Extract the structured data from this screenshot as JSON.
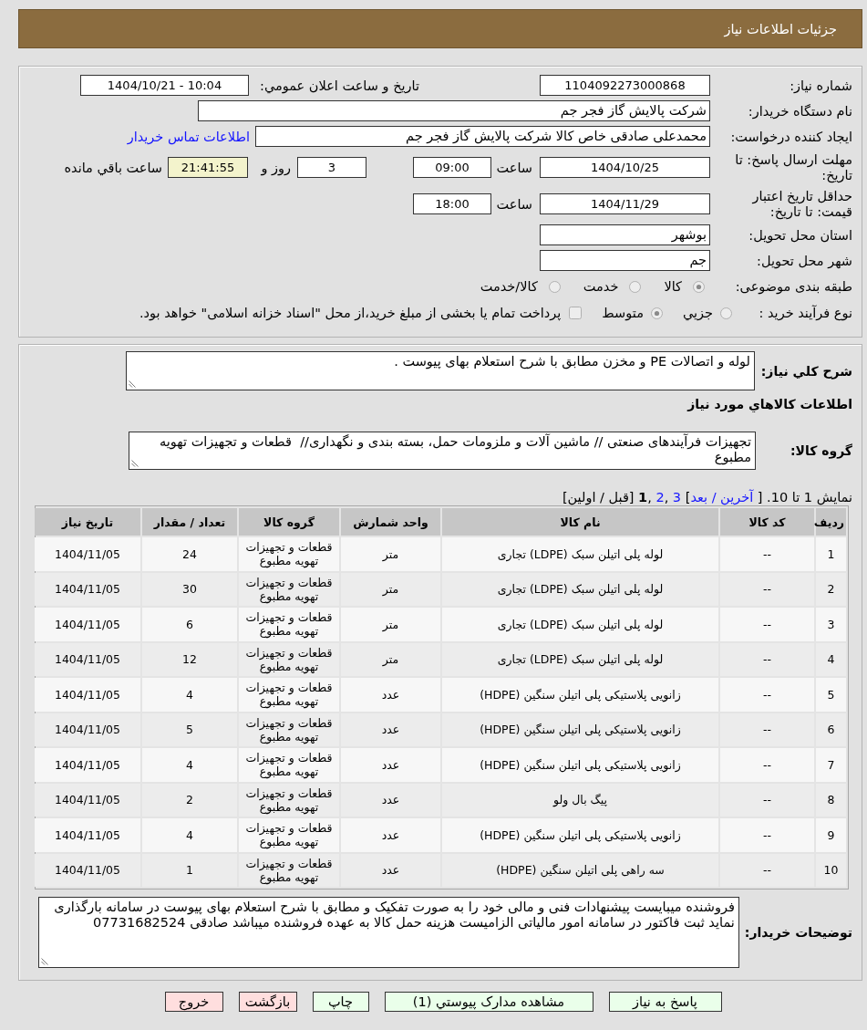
{
  "page": {
    "title": "جزئیات اطلاعات نیاز"
  },
  "details": {
    "need_number": {
      "label": "شماره نیاز:",
      "value": "1104092273000868"
    },
    "announce": {
      "label": "تاريخ و ساعت اعلان عمومي:",
      "value": "1404/10/21 - 10:04"
    },
    "buyer_org": {
      "label": "نام دستگاه خريدار:",
      "value": "شرکت پالايش گاز فجر جم"
    },
    "requester": {
      "label": "ايجاد کننده درخواست:",
      "value": "محمدعلی صادقی خاص کالا شرکت پالایش گاز فجر جم",
      "link": "اطلاعات تماس خريدار"
    },
    "reply_deadline": {
      "label": "مهلت ارسال پاسخ: تا تاریخ:",
      "date": "1404/10/25",
      "time_label": "ساعت",
      "time": "09:00",
      "days": "3",
      "days_label": "روز و",
      "remaining": "21:41:55",
      "remaining_label": "ساعت باقي مانده"
    },
    "price_validity": {
      "label": "حداقل تاريخ اعتبار قيمت: تا تاريخ:",
      "date": "1404/11/29",
      "time_label": "ساعت",
      "time": "18:00"
    },
    "province": {
      "label": "استان محل تحويل:",
      "value": "بوشهر"
    },
    "city": {
      "label": "شهر محل تحويل:",
      "value": "جم"
    },
    "category": {
      "label": "طبقه بندی موضوعی:",
      "options": [
        {
          "label": "کالا",
          "selected": true
        },
        {
          "label": "خدمت",
          "selected": false
        },
        {
          "label": "کالا/خدمت",
          "selected": false
        }
      ]
    },
    "purchase_type": {
      "label": "نوع فرآيند خريد :",
      "options": [
        {
          "label": "جزيي",
          "selected": false
        },
        {
          "label": "متوسط",
          "selected": true
        }
      ],
      "treasury": {
        "label": "پرداخت تمام یا بخشی از مبلغ خرید،از محل \"اسناد خزانه اسلامی\" خواهد بود.",
        "checked": false
      }
    }
  },
  "needs": {
    "description": {
      "label": "شرح کلي نياز:",
      "value": "لوله و اتصالات PE و مخزن مطابق با شرح استعلام بهای پیوست ."
    },
    "items_heading": "اطلاعات کالاهاي مورد نياز",
    "product_group": {
      "label": "گروه کالا:",
      "value": "تجهیزات فرآیندهای صنعتی // ماشین آلات و ملزومات حمل، بسته بندی و نگهداری//  قطعات و تجهیزات تهویه مطبوع"
    },
    "pagination": {
      "parts": [
        {
          "kind": "text",
          "text": "نمايش 1 تا 10. [ "
        },
        {
          "kind": "link",
          "text": "آخرين / بعد"
        },
        {
          "kind": "text",
          "text": "] "
        },
        {
          "kind": "link",
          "text": "3"
        },
        {
          "kind": "text",
          "text": " ,"
        },
        {
          "kind": "link",
          "text": "2"
        },
        {
          "kind": "text",
          "text": " ,"
        },
        {
          "kind": "current",
          "text": "1"
        },
        {
          "kind": "text",
          "text": " [قبل / اولين]"
        }
      ]
    },
    "table": {
      "columns": [
        "ردیف",
        "کد کالا",
        "نام کالا",
        "واحد شمارش",
        "گروه کالا",
        "تعداد / مقدار",
        "تاریخ نیاز"
      ],
      "rows": [
        [
          "1",
          "--",
          "لوله پلی اتیلن سبک (LDPE) تجاری",
          "متر",
          "قطعات و تجهیزات تهویه مطبوع",
          "24",
          "1404/11/05"
        ],
        [
          "2",
          "--",
          "لوله پلی اتیلن سبک (LDPE) تجاری",
          "متر",
          "قطعات و تجهیزات تهویه مطبوع",
          "30",
          "1404/11/05"
        ],
        [
          "3",
          "--",
          "لوله پلی اتیلن سبک (LDPE) تجاری",
          "متر",
          "قطعات و تجهیزات تهویه مطبوع",
          "6",
          "1404/11/05"
        ],
        [
          "4",
          "--",
          "لوله پلی اتیلن سبک (LDPE) تجاری",
          "متر",
          "قطعات و تجهیزات تهویه مطبوع",
          "12",
          "1404/11/05"
        ],
        [
          "5",
          "--",
          "زانویی پلاستیکی پلی اتیلن سنگین (HDPE)",
          "عدد",
          "قطعات و تجهیزات تهویه مطبوع",
          "4",
          "1404/11/05"
        ],
        [
          "6",
          "--",
          "زانویی پلاستیکی پلی اتیلن سنگین (HDPE)",
          "عدد",
          "قطعات و تجهیزات تهویه مطبوع",
          "5",
          "1404/11/05"
        ],
        [
          "7",
          "--",
          "زانویی پلاستیکی پلی اتیلن سنگین (HDPE)",
          "عدد",
          "قطعات و تجهیزات تهویه مطبوع",
          "4",
          "1404/11/05"
        ],
        [
          "8",
          "--",
          "پیگ بال ولو",
          "عدد",
          "قطعات و تجهیزات تهویه مطبوع",
          "2",
          "1404/11/05"
        ],
        [
          "9",
          "--",
          "زانویی پلاستیکی پلی اتیلن سنگین (HDPE)",
          "عدد",
          "قطعات و تجهیزات تهویه مطبوع",
          "4",
          "1404/11/05"
        ],
        [
          "10",
          "--",
          "سه راهی پلی اتیلن سنگین (HDPE)",
          "عدد",
          "قطعات و تجهیزات تهویه مطبوع",
          "1",
          "1404/11/05"
        ]
      ]
    },
    "buyer_notes": {
      "label": "توضیحات خریدار:",
      "value": "فروشنده میبایست پیشنهادات فنی و مالی خود را به صورت تفکیک و مطابق با شرح استعلام بهای پیوست در سامانه بارگذاری نماید ثبت فاکتور در سامانه امور مالیاتی الزامیست هزینه حمل کالا به عهده فروشنده میباشد صادقی 07731682524"
    }
  },
  "buttons": [
    {
      "label": "پاسخ به نياز",
      "color": "#eaffea"
    },
    {
      "label": "مشاهده مدارک پيوستي (1)",
      "color": "#eaffea"
    },
    {
      "label": "چاپ",
      "color": "#eaffea"
    },
    {
      "label": "بازگشت",
      "color": "#ffdede"
    },
    {
      "label": "خروج",
      "color": "#ffdede"
    }
  ]
}
